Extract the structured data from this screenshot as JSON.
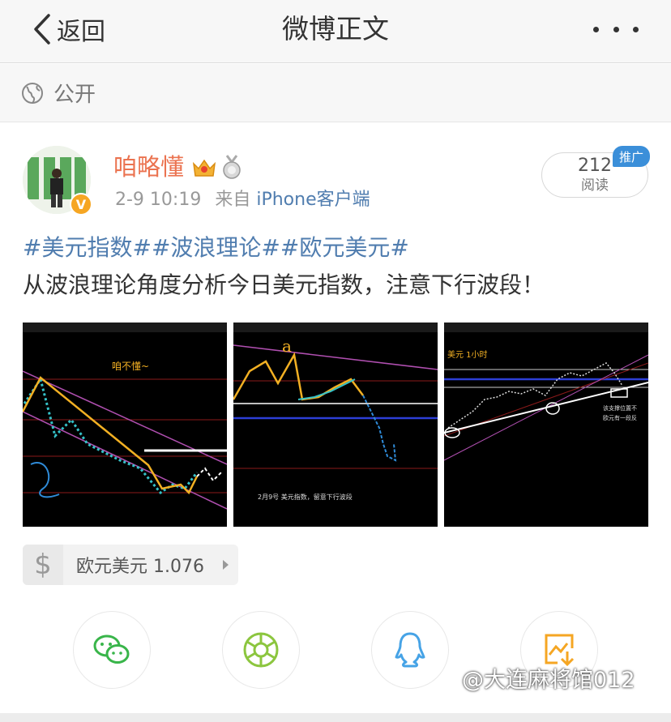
{
  "nav": {
    "back_label": "返回",
    "title": "微博正文"
  },
  "visibility": {
    "label": "公开"
  },
  "author": {
    "name": "咱略懂",
    "verified_mark": "V"
  },
  "post": {
    "date": "2-9 10:19",
    "source_prefix": "来自",
    "source": "iPhone客户端",
    "reads_count": "212",
    "reads_label": "阅读",
    "promo_badge": "推广",
    "hashtags": [
      "#美元指数#",
      "#波浪理论#",
      "#欧元美元#"
    ],
    "text": "从波浪理论角度分析今日美元指数，注意下行波段！"
  },
  "images": [
    {
      "annotation": "咱不懂~"
    },
    {
      "annotation": "2月9号 美元指数，留意下行波段"
    },
    {
      "annotation": "美元 1小时",
      "note_1": "该支撑位置不",
      "note_2": "欧元有一段反"
    }
  ],
  "stock_card": {
    "symbol_icon": "$",
    "label": "欧元美元 1.076"
  },
  "share_buttons": [
    "wechat-icon",
    "moments-icon",
    "qq-icon",
    "save-image-icon"
  ],
  "watermark": "@大连麻将馆012",
  "colors": {
    "link_blue": "#507daf",
    "username_orange": "#eb7350",
    "nav_bg": "#f7f7f7"
  }
}
